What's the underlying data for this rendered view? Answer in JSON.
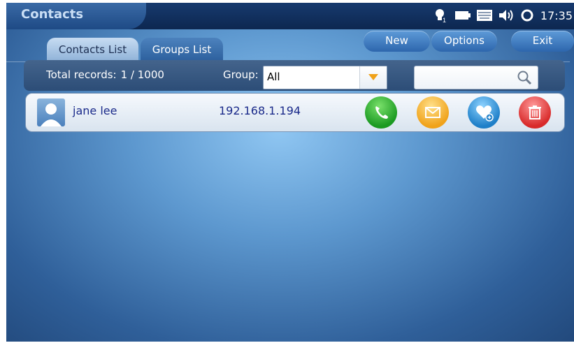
{
  "app": {
    "title": "Contacts"
  },
  "status_bar": {
    "icons": [
      "lightbulb-icon",
      "battery-icon",
      "keyboard-icon",
      "speaker-icon",
      "sync-icon"
    ],
    "bulb_badge": "1",
    "time": "17:35"
  },
  "tabs": [
    {
      "label": "Contacts List",
      "active": true
    },
    {
      "label": "Groups List",
      "active": false
    }
  ],
  "toolbar": {
    "new_label": "New",
    "options_label": "Options",
    "exit_label": "Exit"
  },
  "filter": {
    "total_label": "Total records:",
    "total_count": "1 / 1000",
    "group_label": "Group:",
    "group_value": "All",
    "search_value": ""
  },
  "contacts": [
    {
      "name": "jane lee",
      "address": "192.168.1.194"
    }
  ],
  "colors": {
    "accent": "#2d66ad",
    "call": "#1b9a22",
    "message": "#f0a21a",
    "favorite": "#1e7fc8",
    "delete": "#d82a2a"
  }
}
